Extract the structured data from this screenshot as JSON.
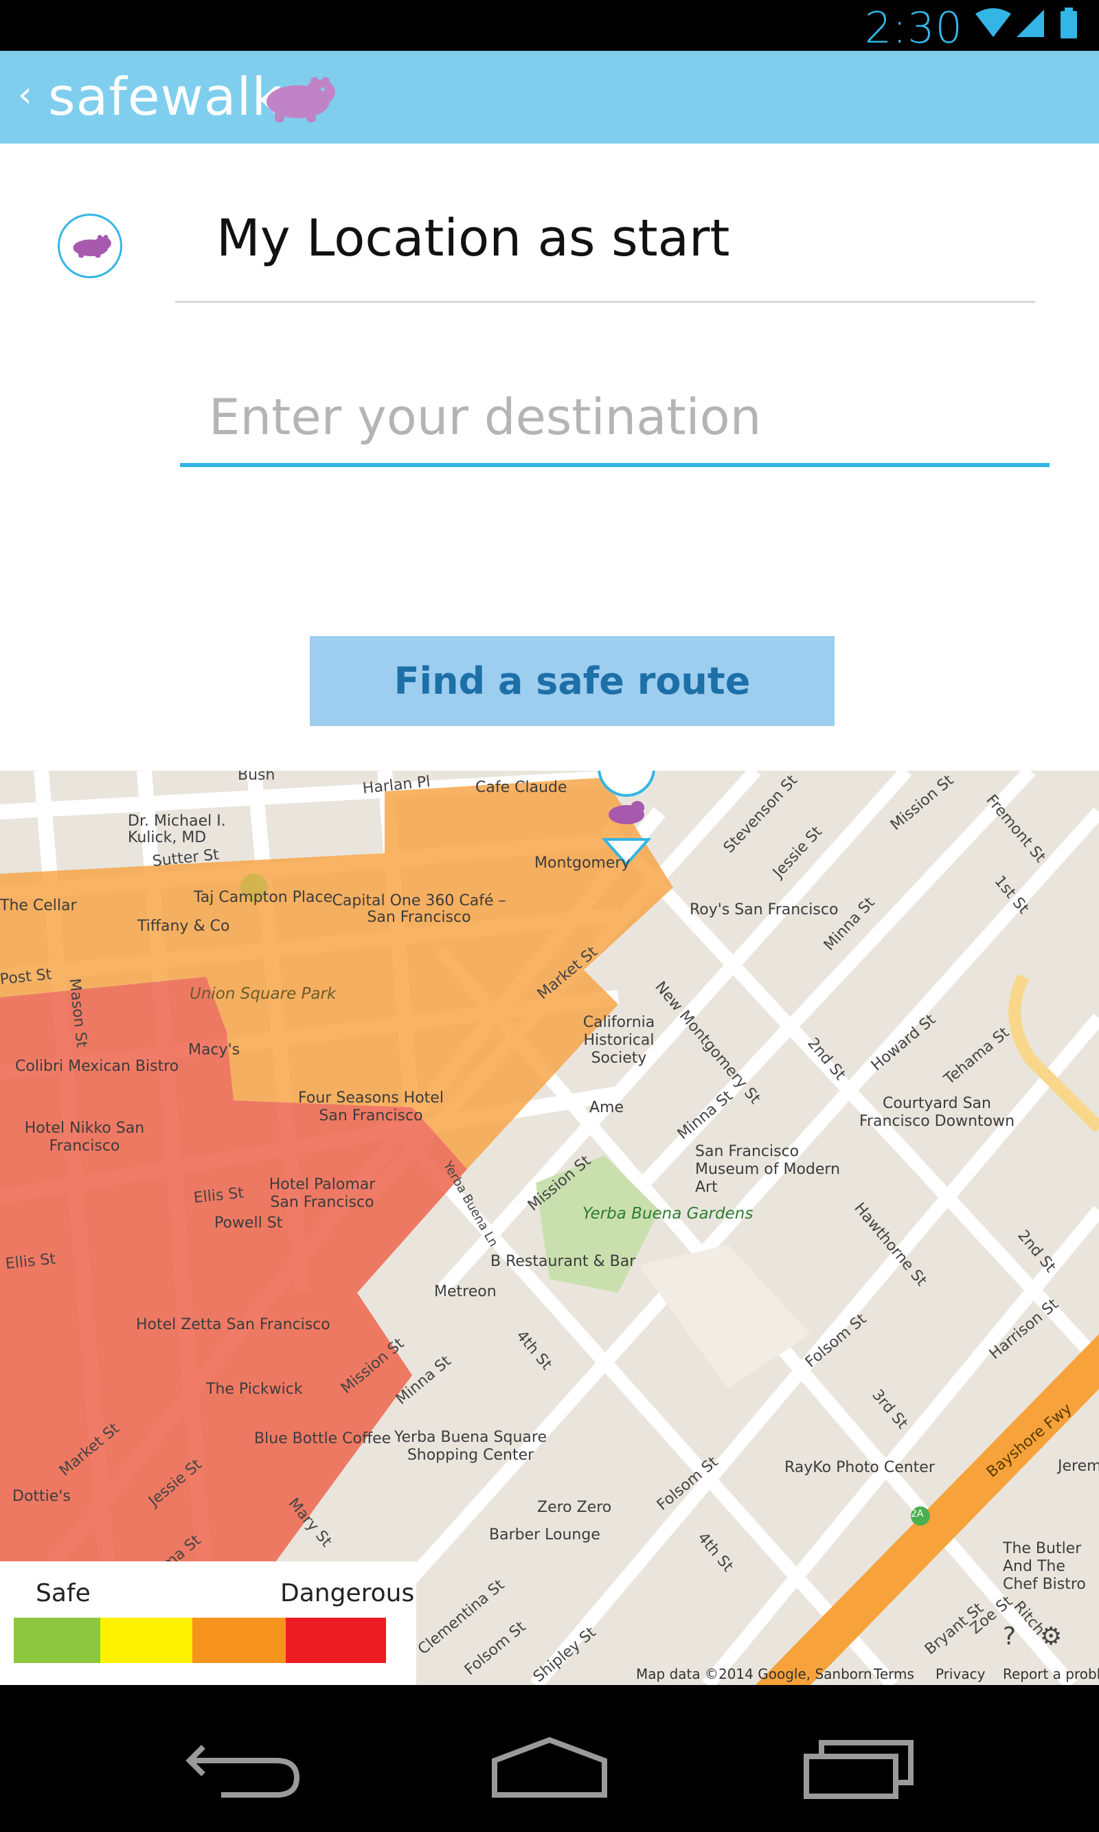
{
  "status": {
    "time": "2:30"
  },
  "app": {
    "back_glyph": "‹",
    "title": "safewalk",
    "brand_color": "#7fceee",
    "accent_color": "#33b5e5",
    "logo_color": "#c084c6"
  },
  "form": {
    "start_value": "My Location as start",
    "destination_placeholder": "Enter your destination",
    "find_button_label": "Find a safe route"
  },
  "map": {
    "places": [
      "Cafe Claude",
      "Dr. Michael I. Kulick, MD",
      "Taj Campton Place",
      "Tiffany & Co",
      "The Cellar",
      "Capital One 360 Café – San Francisco",
      "Montgomery",
      "Roy's San Francisco",
      "Union Square Park",
      "Macy's",
      "Colibri Mexican Bistro",
      "California Historical Society",
      "Ame",
      "Four Seasons Hotel San Francisco",
      "Hotel Nikko San Francisco",
      "Courtyard San Francisco Downtown",
      "San Francisco Museum of Modern Art",
      "Hotel Palomar San Francisco",
      "Powell St",
      "Yerba Buena Gardens",
      "B Restaurant & Bar",
      "Metreon",
      "Hotel Zetta San Francisco",
      "The Pickwick",
      "Blue Bottle Coffee",
      "Yerba Buena Square Shopping Center",
      "RayKo Photo Center",
      "Zero Zero",
      "Barber Lounge",
      "Dottie's",
      "The Butler And The Chef Bistro",
      "Jerem"
    ],
    "streets": [
      "Bush",
      "Harlan Pl",
      "Sutter St",
      "Post St",
      "Mason St",
      "Stevenson St",
      "Jessie St",
      "Mission St",
      "Fremont St",
      "1st St",
      "Minna St",
      "Market St",
      "New Montgomery St",
      "2nd St",
      "Howard St",
      "Tehama St",
      "Minna St",
      "Ellis St",
      "Ellis St",
      "Yerba Buena Ln",
      "Mission St",
      "Hawthorne St",
      "2nd St",
      "Harrison St",
      "Folsom St",
      "4th St",
      "Minna St",
      "Mission St",
      "3rd St",
      "Bayshore Fwy",
      "Folsom St",
      "Market St",
      "Jessie St",
      "Mary St",
      "4th St",
      "Natoma St",
      "Clementina St",
      "Folsom St",
      "Shipley St",
      "Bryant St",
      "Zoe St",
      "Ritch"
    ],
    "highway_shield": "2A",
    "footer": {
      "attribution": "Map data ©2014 Google, Sanborn",
      "terms": "Terms",
      "privacy": "Privacy",
      "report": "Report a problem"
    },
    "legend": {
      "safe_label": "Safe",
      "dangerous_label": "Dangerous",
      "colors": [
        "#8dc63f",
        "#fff200",
        "#f7941d",
        "#ed1c24"
      ]
    },
    "zone_colors": {
      "moderate": "#f7a64a",
      "dangerous": "#ee6a52"
    }
  }
}
